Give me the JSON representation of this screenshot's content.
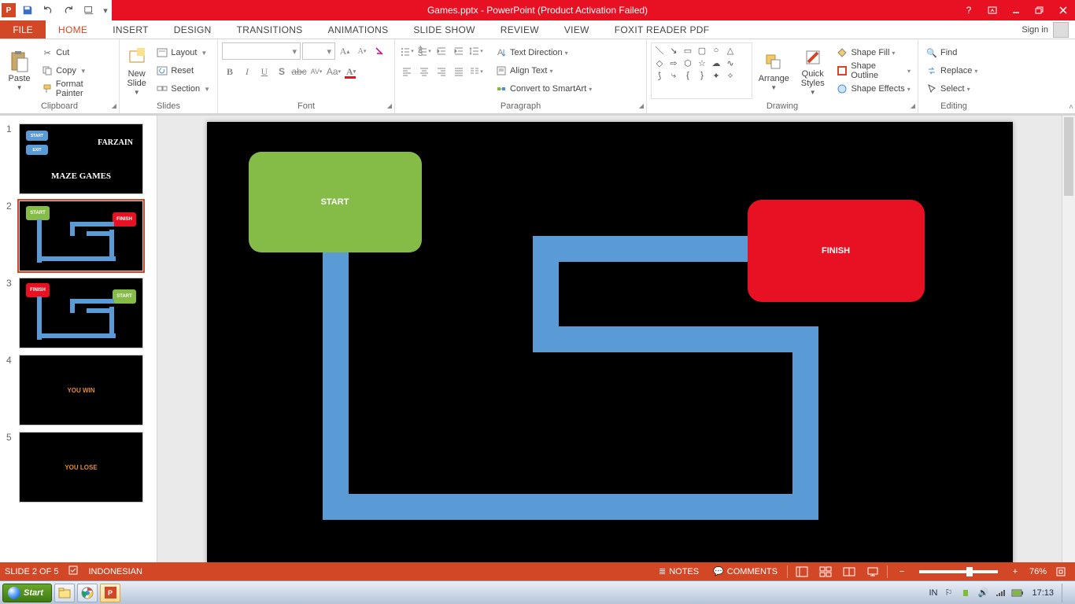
{
  "title": "Games.pptx -  PowerPoint (Product Activation Failed)",
  "qat": {
    "app_icon": "P"
  },
  "window_controls": {
    "help": "?"
  },
  "tabs": {
    "file": "FILE",
    "home": "HOME",
    "insert": "INSERT",
    "design": "DESIGN",
    "transitions": "TRANSITIONS",
    "animations": "ANIMATIONS",
    "slideshow": "SLIDE SHOW",
    "review": "REVIEW",
    "view": "VIEW",
    "foxit": "FOXIT READER PDF",
    "signin": "Sign in"
  },
  "ribbon": {
    "clipboard": {
      "paste": "Paste",
      "cut": "Cut",
      "copy": "Copy",
      "format_painter": "Format Painter",
      "label": "Clipboard"
    },
    "slides": {
      "new_slide": "New\nSlide",
      "layout": "Layout",
      "reset": "Reset",
      "section": "Section",
      "label": "Slides"
    },
    "font": {
      "label": "Font"
    },
    "paragraph": {
      "text_direction": "Text Direction",
      "align_text": "Align Text",
      "smartart": "Convert to SmartArt",
      "label": "Paragraph"
    },
    "drawing": {
      "arrange": "Arrange",
      "quick": "Quick\nStyles",
      "shape_fill": "Shape Fill",
      "shape_outline": "Shape Outline",
      "shape_effects": "Shape Effects",
      "label": "Drawing"
    },
    "editing": {
      "find": "Find",
      "replace": "Replace",
      "select": "Select",
      "label": "Editing"
    }
  },
  "slide": {
    "start": "START",
    "finish": "FINISH"
  },
  "thumbs": [
    {
      "n": "1",
      "type": "title",
      "farzain": "FARZAIN",
      "maze": "MAZE GAMES",
      "start": "START",
      "exit": "EXIT"
    },
    {
      "n": "2",
      "type": "maze",
      "start": "START",
      "finish": "FINISH"
    },
    {
      "n": "3",
      "type": "maze_rev",
      "start": "START",
      "finish": "FINISH"
    },
    {
      "n": "4",
      "type": "result",
      "text": "YOU WIN"
    },
    {
      "n": "5",
      "type": "result",
      "text": "YOU LOSE"
    }
  ],
  "status": {
    "slide_counter": "SLIDE 2 OF 5",
    "language": "INDONESIAN",
    "notes": "NOTES",
    "comments": "COMMENTS",
    "zoom": "76%"
  },
  "taskbar": {
    "start": "Start",
    "lang": "IN",
    "clock": "17:13"
  }
}
